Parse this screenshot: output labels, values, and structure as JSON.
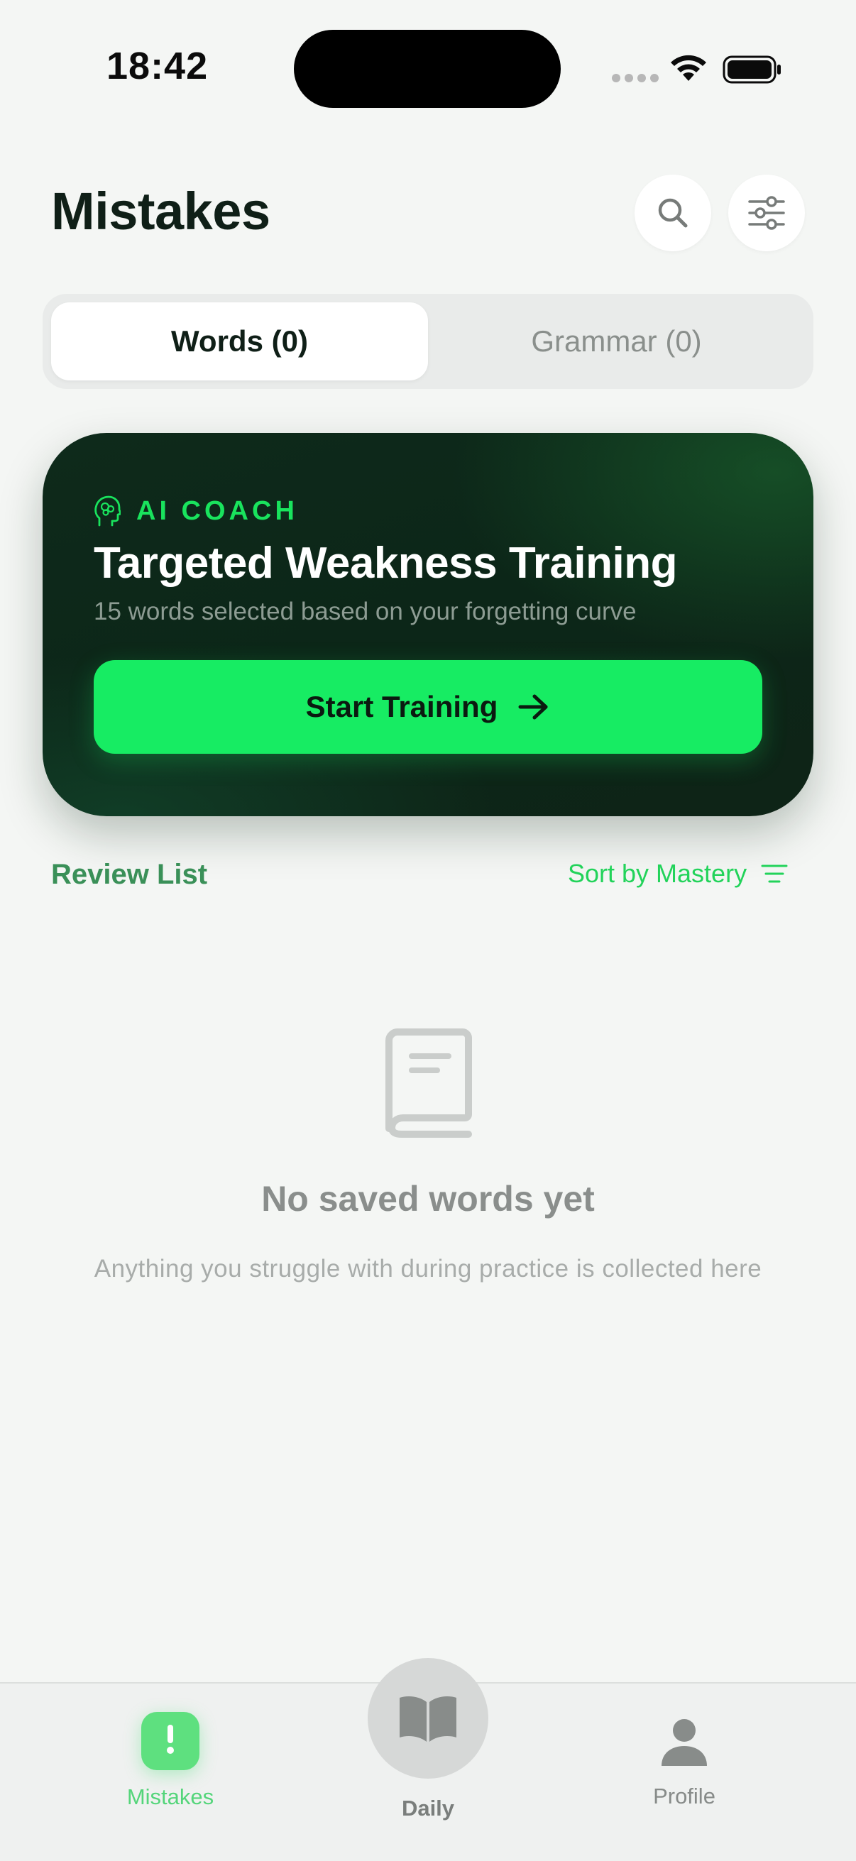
{
  "status_bar": {
    "time": "18:42"
  },
  "header": {
    "title": "Mistakes",
    "search_icon": "search-icon",
    "filter_icon": "sliders-icon"
  },
  "tabs": [
    {
      "label": "Words (0)",
      "active": true
    },
    {
      "label": "Grammar (0)",
      "active": false
    }
  ],
  "coach_card": {
    "tag": "AI COACH",
    "tag_icon": "brain-head-icon",
    "title": "Targeted Weakness Training",
    "subtitle": "15 words selected based on your forgetting curve",
    "button_label": "Start Training",
    "button_icon": "arrow-right-icon"
  },
  "review_list": {
    "title": "Review List",
    "sort_label": "Sort by Mastery",
    "sort_icon": "sort-lines-icon"
  },
  "empty_state": {
    "icon": "book-icon",
    "title": "No saved words yet",
    "subtitle": "Anything you struggle with during practice is collected here"
  },
  "bottom_nav": {
    "items": [
      {
        "label": "Mistakes",
        "icon": "exclamation-bubble-icon",
        "active": true
      },
      {
        "label": "Daily",
        "icon": "open-book-icon",
        "active": false
      },
      {
        "label": "Profile",
        "icon": "person-icon",
        "active": false
      }
    ]
  },
  "colors": {
    "accent": "#17ec63",
    "card_dark": "#0e2a1b",
    "background": "#f4f6f4",
    "review_title": "#3a9058"
  }
}
